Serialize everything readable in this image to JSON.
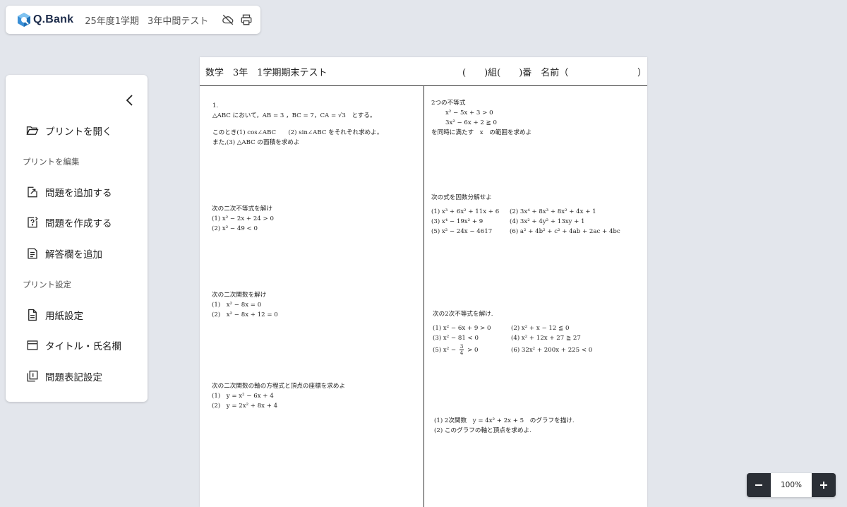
{
  "app": {
    "logo_text": "Q.Bank"
  },
  "header": {
    "term": "25年度1学期",
    "test_name": "3年中間テスト",
    "icons": [
      "cloud-off-icon",
      "printer-icon"
    ]
  },
  "sidebar": {
    "open_print": "プリントを開く",
    "section_edit": "プリントを編集",
    "add_question": "問題を追加する",
    "create_question": "問題を作成する",
    "add_answer_field": "解答欄を追加",
    "section_settings": "プリント設定",
    "paper_settings": "用紙設定",
    "title_name_field": "タイトル・氏名欄",
    "question_notation": "問題表記設定"
  },
  "paper": {
    "title": "数学　3年　1学期期末テスト",
    "name_field": "(　　)組(　　)番　名前（",
    "name_field_close": "）",
    "left": {
      "q1": {
        "number": "1.",
        "l1": "△ABC において，AB = 3 ，BC = 7，CA = √3　とする。",
        "l2": "このとき(1) cos∠ABC　　(2) sin∠ABC をそれぞれ求めよ。",
        "l3": "また,(3) △ABC の面積を求めよ"
      },
      "q2": {
        "title": "次の二次不等式を解け",
        "a": "(1)  x² − 2x + 24 > 0",
        "b": "(2)  x² − 49 < 0"
      },
      "q3": {
        "title": "次の二次関数を解け",
        "a": "(1)　x² − 8x = 0",
        "b": "(2)　x² − 8x + 12 = 0"
      },
      "q4": {
        "title": "次の二次関数の軸の方程式と頂点の座標を求めよ",
        "a": "(1)　y = x² − 6x + 4",
        "b": "(2)　y = 2x² + 8x + 4"
      }
    },
    "right": {
      "q5": {
        "title": "2つの不等式",
        "a": "x² − 5x + 3 > 0",
        "b": "3x² − 6x + 2 ≧ 0",
        "c": "を同時に満たす　x　の範囲を求めよ"
      },
      "q6": {
        "title": "次の式を因数分解せよ",
        "items": [
          "(1)  x³ + 6x² + 11x + 6",
          "(2)  3x⁴ + 8x³ + 8x² + 4x + 1",
          "(3)  x⁴ − 19x² + 9",
          "(4)  3x² + 4y² + 13xy + 1",
          "(5)  x² − 24x − 4617",
          "(6)  a² + 4b² + c² + 4ab + 2ac + 4bc"
        ]
      },
      "q7": {
        "title": "次の2次不等式を解け.",
        "items": [
          "(1)  x² − 6x + 9 > 0",
          "(2)  x² + x − 12 ≦ 0",
          "(3)  x² − 81 < 0",
          "(4)  x² + 12x + 27 ≧ 27",
          "(5)  x² − ",
          "(6)  32x² + 200x + 225 < 0"
        ],
        "frac_num": "3",
        "frac_den": "4",
        "frac_tail": " > 0"
      },
      "q8": {
        "a": "(1)  2次関数　y = 4x² + 2x + 5　のグラフを描け.",
        "b": "(2)  このグラフの軸と頂点を求めよ."
      }
    }
  },
  "zoom": {
    "level": "100%"
  }
}
